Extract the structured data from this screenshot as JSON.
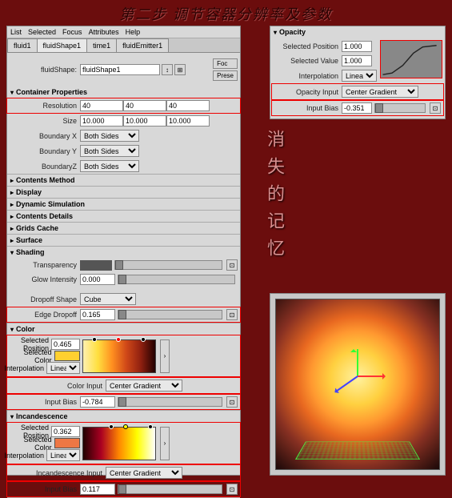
{
  "page_title": "第二步 调节容器分辨率及参数",
  "side_text": "消失的记忆",
  "menu": [
    "List",
    "Selected",
    "Focus",
    "Attributes",
    "Help"
  ],
  "tabs": [
    "fluid1",
    "fluidShape1",
    "time1",
    "fluidEmitter1"
  ],
  "shape_lbl": "fluidShape:",
  "shape_val": "fluidShape1",
  "btn_focus": "Foc",
  "btn_preset": "Prese",
  "sections": {
    "container": "Container Properties",
    "contents": "Contents Method",
    "display": "Display",
    "dynsim": "Dynamic Simulation",
    "cdet": "Contents Details",
    "gcache": "Grids Cache",
    "surface": "Surface",
    "shading": "Shading",
    "color": "Color",
    "incan": "Incandescence"
  },
  "cp": {
    "res_lbl": "Resolution",
    "res": [
      "40",
      "40",
      "40"
    ],
    "size_lbl": "Size",
    "size": [
      "10.000",
      "10.000",
      "10.000"
    ],
    "bx_lbl": "Boundary X",
    "by_lbl": "Boundary Y",
    "bz_lbl": "BoundaryZ",
    "bval": "Both Sides"
  },
  "sh": {
    "trans_lbl": "Transparency",
    "glow_lbl": "Glow Intensity",
    "glow": "0.000",
    "drop_lbl": "Dropoff Shape",
    "drop_val": "Cube",
    "edge_lbl": "Edge Dropoff",
    "edge": "0.165"
  },
  "col": {
    "sp_lbl": "Selected Position",
    "sp": "0.465",
    "sc_lbl": "Selected Color",
    "int_lbl": "Interpolation",
    "int_val": "Linear",
    "ci_lbl": "Color Input",
    "ci_val": "Center Gradient",
    "ib_lbl": "Input Bias",
    "ib": "-0.784"
  },
  "inc": {
    "sp_lbl": "Selected Position",
    "sp": "0.362",
    "sc_lbl": "Selected Color",
    "int_lbl": "Interpolation",
    "int_val": "Linear",
    "ii_lbl": "Incandescence Input",
    "ii_val": "Center Gradient",
    "ib_lbl": "Input Bias",
    "ib": "0.117"
  },
  "op": {
    "title": "Opacity",
    "sp_lbl": "Selected Position",
    "sp": "1.000",
    "sv_lbl": "Selected Value",
    "sv": "1.000",
    "int_lbl": "Interpolation",
    "int_val": "Linear",
    "oi_lbl": "Opacity Input",
    "oi_val": "Center Gradient",
    "ib_lbl": "Input Bias",
    "ib": "-0.351"
  }
}
